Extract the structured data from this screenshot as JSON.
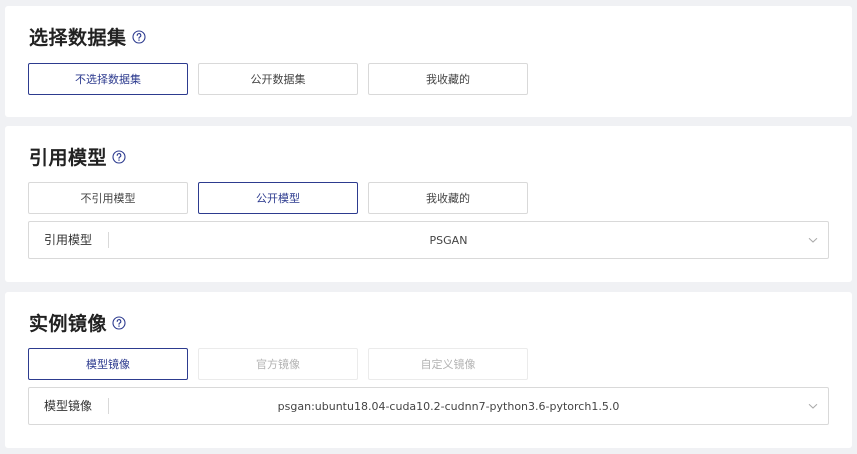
{
  "dataset": {
    "title": "选择数据集",
    "options": [
      "不选择数据集",
      "公开数据集",
      "我收藏的"
    ]
  },
  "model": {
    "title": "引用模型",
    "options": [
      "不引用模型",
      "公开模型",
      "我收藏的"
    ],
    "select_label": "引用模型",
    "select_value": "PSGAN"
  },
  "image": {
    "title": "实例镜像",
    "options": [
      "模型镜像",
      "官方镜像",
      "自定义镜像"
    ],
    "select_label": "模型镜像",
    "select_value": "psgan:ubuntu18.04-cuda10.2-cudnn7-python3.6-pytorch1.5.0"
  },
  "colors": {
    "accent": "#2d3b8f",
    "border": "#d9d9d9",
    "background": "#f0f1f4"
  },
  "icons": {
    "help": "question-circle-icon",
    "dropdown": "chevron-down-icon"
  }
}
